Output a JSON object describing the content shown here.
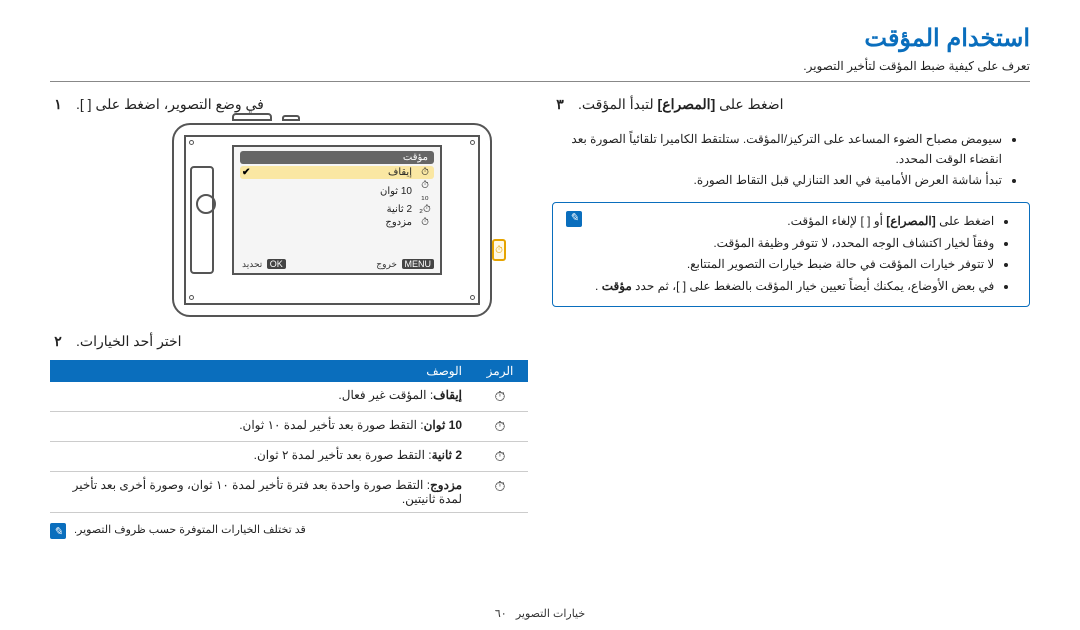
{
  "title": "استخدام المؤقت",
  "intro": "تعرف على كيفية ضبط المؤقت لتأخير التصوير.",
  "steps": {
    "s1_num": "١",
    "s1_text": "في وضع التصوير، اضغط على [   ].",
    "s2_num": "٢",
    "s2_text": "اختر أحد الخيارات.",
    "s3_num": "٣",
    "s3_heading_plain_a": "اضغط على ",
    "s3_heading_bold": "[المصراع]",
    "s3_heading_plain_b": " لتبدأ المؤقت.",
    "s3_b1": "سيومض مصباح الضوء المساعد على التركيز/المؤقت. ستلتقط الكاميرا تلقائياً الصورة بعد انقضاء الوقت المحدد.",
    "s3_b2": "تبدأ شاشة العرض الأمامية في العد التنازلي قبل التقاط الصورة."
  },
  "camera": {
    "menu_title": "مؤقت",
    "row0_icon": "⏱︎",
    "row0_label": "إيقاف",
    "row1_icon": "⏱︎₁₀",
    "row1_label": "10 ثوان",
    "row2_icon": "⏱︎₂",
    "row2_label": "2 ثانية",
    "row3_icon": "⏱︎",
    "row3_label": "مزدوج",
    "btn_menu": "MENU",
    "btn_menu_lbl": "خروج",
    "btn_ok": "OK",
    "btn_ok_lbl": "تحديد",
    "side_badge": "⏱"
  },
  "table": {
    "h_icon": "الرمز",
    "h_desc": "الوصف",
    "rows": [
      {
        "icon": "⏱︎",
        "label": "إيقاف",
        "desc": ": المؤقت غير فعال."
      },
      {
        "icon": "⏱︎",
        "label": "10 ثوان",
        "desc": ": التقط صورة بعد تأخير لمدة ١٠ ثوان."
      },
      {
        "icon": "⏱︎",
        "label": "2 ثانية",
        "desc": ": التقط صورة بعد تأخير لمدة ٢ ثوان."
      },
      {
        "icon": "⏱︎",
        "label": "مزدوج",
        "desc": ": التقط صورة واحدة بعد فترة تأخير لمدة ١٠ ثوان، وصورة أخرى بعد تأخير لمدة ثانيتين."
      }
    ],
    "footnote": "قد تختلف الخيارات المتوفرة حسب ظروف التصوير."
  },
  "tips": {
    "t1_a": "اضغط على ",
    "t1_bold": "[المصراع]",
    "t1_b": " أو [   ] لإلغاء المؤقت.",
    "t2": "وفقاً لخيار اكتشاف الوجه المحدد، لا تتوفر وظيفة المؤقت.",
    "t3": "لا تتوفر خيارات المؤقت في حالة ضبط خيارات التصوير المتتابع.",
    "t4_a": "في بعض الأوضاع، يمكنك أيضاً تعيين خيار المؤقت بالضغط على [   ]، ثم حدد ",
    "t4_bold": "مؤقت",
    "t4_b": "."
  },
  "footer": {
    "section": "خيارات التصوير",
    "page": "٦٠"
  }
}
